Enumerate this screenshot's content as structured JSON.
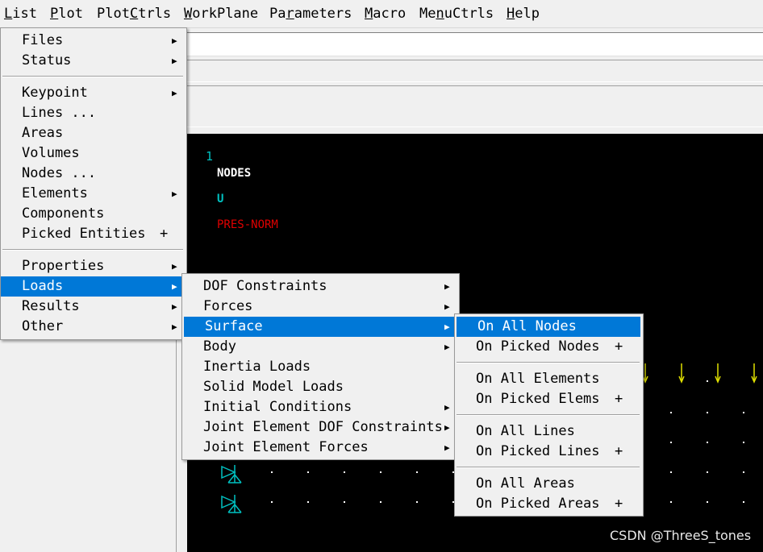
{
  "menubar": {
    "items": [
      {
        "pre": "",
        "u": "L",
        "post": "ist"
      },
      {
        "pre": "",
        "u": "P",
        "post": "lot"
      },
      {
        "pre": "Plot",
        "u": "C",
        "post": "trls"
      },
      {
        "pre": "",
        "u": "W",
        "post": "orkPlane"
      },
      {
        "pre": "Pa",
        "u": "r",
        "post": "ameters"
      },
      {
        "pre": "",
        "u": "M",
        "post": "acro"
      },
      {
        "pre": "Me",
        "u": "n",
        "post": "uCtrls"
      },
      {
        "pre": "",
        "u": "H",
        "post": "elp"
      }
    ]
  },
  "list_menu": {
    "items": [
      {
        "label": "Files",
        "arrow": "▶"
      },
      {
        "label": "Status",
        "arrow": "▶"
      },
      {
        "label": "Keypoint",
        "arrow": "▶"
      },
      {
        "label": "Lines ...",
        "arrow": ""
      },
      {
        "label": "Areas",
        "arrow": ""
      },
      {
        "label": "Volumes",
        "arrow": ""
      },
      {
        "label": "Nodes ...",
        "arrow": ""
      },
      {
        "label": "Elements",
        "arrow": "▶"
      },
      {
        "label": "Components",
        "arrow": ""
      },
      {
        "label": "Picked Entities",
        "plus": "+"
      },
      {
        "label": "Properties",
        "arrow": "▶"
      },
      {
        "label": "Loads",
        "arrow": "▶"
      },
      {
        "label": "Results",
        "arrow": "▶"
      },
      {
        "label": "Other",
        "arrow": "▶"
      }
    ]
  },
  "loads_menu": {
    "items": [
      {
        "label": "DOF Constraints",
        "arrow": "▶"
      },
      {
        "label": "Forces",
        "arrow": "▶"
      },
      {
        "label": "Surface",
        "arrow": "▶"
      },
      {
        "label": "Body",
        "arrow": "▶"
      },
      {
        "label": "Inertia Loads",
        "arrow": ""
      },
      {
        "label": "Solid Model Loads",
        "arrow": ""
      },
      {
        "label": "Initial Conditions",
        "arrow": "▶"
      },
      {
        "label": "Joint Element DOF Constraints",
        "arrow": "▶"
      },
      {
        "label": "Joint Element Forces",
        "arrow": "▶"
      }
    ]
  },
  "surface_menu": {
    "items": [
      {
        "label": "On All Nodes"
      },
      {
        "label": "On Picked Nodes",
        "plus": "+"
      },
      {
        "label": "On All Elements"
      },
      {
        "label": "On Picked Elems",
        "plus": "+"
      },
      {
        "label": "On All Lines"
      },
      {
        "label": "On Picked Lines",
        "plus": "+"
      },
      {
        "label": "On All Areas"
      },
      {
        "label": "On Picked Areas",
        "plus": "+"
      }
    ]
  },
  "graphics": {
    "window_number": "1",
    "title": "NODES",
    "legend_u": "U",
    "legend_pres": "PRES-NORM",
    "colors": {
      "background": "#000000",
      "u": "#00c0c0",
      "pres": "#e00000",
      "text": "#ffffff",
      "arrows": "#e0e000"
    }
  },
  "watermark": "CSDN @ThreeS_tones"
}
